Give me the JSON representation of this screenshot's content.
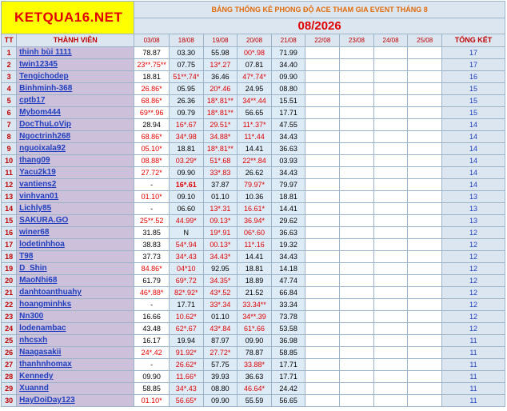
{
  "logo": "KETQUA16.NET",
  "title": "BẢNG THỐNG KÊ PHONG ĐỘ ACE THAM GIA EVENT THÁNG 8",
  "subtitle": "08/2026",
  "headers": {
    "tt": "TT",
    "name": "THÀNH VIÊN",
    "dates": [
      "03/08",
      "18/08",
      "19/08",
      "20/08",
      "21/08",
      "22/08",
      "23/08",
      "24/08",
      "25/08"
    ],
    "total": "TỔNG KẾT"
  },
  "colors": {
    "logo_bg": "#ffff00",
    "logo_text": "#e00000",
    "name_bg": "#ccc0da",
    "name_text": "#1f3fbf",
    "red_score": "#e00000",
    "header_bg": "#dce6f1"
  },
  "rows": [
    {
      "tt": "1",
      "name": "thinh bùi 1111",
      "scores": [
        {
          "v": "78.87",
          "r": 0
        },
        {
          "v": "03.30",
          "r": 0
        },
        {
          "v": "55.98",
          "r": 0
        },
        {
          "v": "00*.98",
          "r": 1
        },
        {
          "v": "71.99",
          "r": 0
        }
      ],
      "total": "17"
    },
    {
      "tt": "2",
      "name": "twin12345",
      "scores": [
        {
          "v": "23**.75**",
          "r": 1
        },
        {
          "v": "07.75",
          "r": 0
        },
        {
          "v": "13*.27",
          "r": 1
        },
        {
          "v": "07.81",
          "r": 0
        },
        {
          "v": "34.40",
          "r": 0
        }
      ],
      "total": "17"
    },
    {
      "tt": "3",
      "name": "Tengichodep",
      "scores": [
        {
          "v": "18.81",
          "r": 0
        },
        {
          "v": "51**.74*",
          "r": 1
        },
        {
          "v": "36.46",
          "r": 0
        },
        {
          "v": "47*.74*",
          "r": 1
        },
        {
          "v": "09.90",
          "r": 0
        }
      ],
      "total": "16"
    },
    {
      "tt": "4",
      "name": "Binhminh-368",
      "scores": [
        {
          "v": "26.86*",
          "r": 1
        },
        {
          "v": "05.95",
          "r": 0
        },
        {
          "v": "20*.46",
          "r": 1
        },
        {
          "v": "24.95",
          "r": 0
        },
        {
          "v": "08.80",
          "r": 0
        }
      ],
      "total": "15"
    },
    {
      "tt": "5",
      "name": "cptb17",
      "scores": [
        {
          "v": "68.86*",
          "r": 1
        },
        {
          "v": "26.36",
          "r": 0
        },
        {
          "v": "18*.81**",
          "r": 1
        },
        {
          "v": "34**.44",
          "r": 1
        },
        {
          "v": "15.51",
          "r": 0
        }
      ],
      "total": "15"
    },
    {
      "tt": "6",
      "name": "Mybom444",
      "scores": [
        {
          "v": "69**.96",
          "r": 1
        },
        {
          "v": "09.79",
          "r": 0
        },
        {
          "v": "18*.81**",
          "r": 1
        },
        {
          "v": "56.65",
          "r": 0
        },
        {
          "v": "17.71",
          "r": 0
        }
      ],
      "total": "15"
    },
    {
      "tt": "7",
      "name": "DocThuLoVip",
      "scores": [
        {
          "v": "28.94",
          "r": 0
        },
        {
          "v": "16*.67",
          "r": 1
        },
        {
          "v": "29.51*",
          "r": 1
        },
        {
          "v": "11*.37*",
          "r": 1
        },
        {
          "v": "47.55",
          "r": 0
        }
      ],
      "total": "14"
    },
    {
      "tt": "8",
      "name": "Ngoctrinh268",
      "scores": [
        {
          "v": "68.86*",
          "r": 1
        },
        {
          "v": "34*.98",
          "r": 1
        },
        {
          "v": "34.88*",
          "r": 1
        },
        {
          "v": "11*.44",
          "r": 1
        },
        {
          "v": "34.43",
          "r": 0
        }
      ],
      "total": "14"
    },
    {
      "tt": "9",
      "name": "nguoixala92",
      "scores": [
        {
          "v": "05.10*",
          "r": 1
        },
        {
          "v": "18.81",
          "r": 0
        },
        {
          "v": "18*.81**",
          "r": 1
        },
        {
          "v": "14.41",
          "r": 0
        },
        {
          "v": "36.63",
          "r": 0
        }
      ],
      "total": "14"
    },
    {
      "tt": "10",
      "name": "thang09",
      "scores": [
        {
          "v": "08.88*",
          "r": 1
        },
        {
          "v": "03.29*",
          "r": 1
        },
        {
          "v": "51*.68",
          "r": 1
        },
        {
          "v": "22**.84",
          "r": 1
        },
        {
          "v": "03.93",
          "r": 0
        }
      ],
      "total": "14"
    },
    {
      "tt": "11",
      "name": "Yacu2k19",
      "scores": [
        {
          "v": "27.72*",
          "r": 1
        },
        {
          "v": "09.90",
          "r": 0
        },
        {
          "v": "33*.83",
          "r": 1
        },
        {
          "v": "26.62",
          "r": 0
        },
        {
          "v": "34.43",
          "r": 0
        }
      ],
      "total": "14"
    },
    {
      "tt": "12",
      "name": "vantiens2",
      "scores": [
        {
          "v": "-",
          "r": 0
        },
        {
          "v": "16*.61",
          "r": 1,
          "b": 1
        },
        {
          "v": "37.87",
          "r": 0
        },
        {
          "v": "79.97*",
          "r": 1
        },
        {
          "v": "79.97",
          "r": 0
        }
      ],
      "total": "14"
    },
    {
      "tt": "13",
      "name": "vinhvan01",
      "scores": [
        {
          "v": "01.10*",
          "r": 1
        },
        {
          "v": "09.10",
          "r": 0
        },
        {
          "v": "01.10",
          "r": 0
        },
        {
          "v": "10.36",
          "r": 0
        },
        {
          "v": "18.81",
          "r": 0
        }
      ],
      "total": "13"
    },
    {
      "tt": "14",
      "name": "Lichly85",
      "scores": [
        {
          "v": "-",
          "r": 0
        },
        {
          "v": "06.60",
          "r": 0
        },
        {
          "v": "13*.31",
          "r": 1
        },
        {
          "v": "16.61*",
          "r": 1
        },
        {
          "v": "14.41",
          "r": 0
        }
      ],
      "total": "13"
    },
    {
      "tt": "15",
      "name": "SAKURA.GO",
      "scores": [
        {
          "v": "25**.52",
          "r": 1
        },
        {
          "v": "44.99*",
          "r": 1
        },
        {
          "v": "09.13*",
          "r": 1
        },
        {
          "v": "36.94*",
          "r": 1
        },
        {
          "v": "29.62",
          "r": 0
        }
      ],
      "total": "13"
    },
    {
      "tt": "16",
      "name": "winer68",
      "scores": [
        {
          "v": "31.85",
          "r": 0
        },
        {
          "v": "N",
          "r": 0
        },
        {
          "v": "19*.91",
          "r": 1
        },
        {
          "v": "06*.60",
          "r": 1
        },
        {
          "v": "36.63",
          "r": 0
        }
      ],
      "total": "12"
    },
    {
      "tt": "17",
      "name": "lodetinhhoa",
      "scores": [
        {
          "v": "38.83",
          "r": 0
        },
        {
          "v": "54*.94",
          "r": 1
        },
        {
          "v": "00.13*",
          "r": 1
        },
        {
          "v": "11*.16",
          "r": 1
        },
        {
          "v": "19.32",
          "r": 0
        }
      ],
      "total": "12"
    },
    {
      "tt": "18",
      "name": "T98",
      "scores": [
        {
          "v": "37.73",
          "r": 0
        },
        {
          "v": "34*.43",
          "r": 1
        },
        {
          "v": "34.43*",
          "r": 1
        },
        {
          "v": "14.41",
          "r": 0
        },
        {
          "v": "34.43",
          "r": 0
        }
      ],
      "total": "12"
    },
    {
      "tt": "19",
      "name": "D_Shin",
      "scores": [
        {
          "v": "84.86*",
          "r": 1
        },
        {
          "v": "04*10",
          "r": 1
        },
        {
          "v": "92.95",
          "r": 0
        },
        {
          "v": "18.81",
          "r": 0
        },
        {
          "v": "14.18",
          "r": 0
        }
      ],
      "total": "12"
    },
    {
      "tt": "20",
      "name": "MaoNhi68",
      "scores": [
        {
          "v": "61.79",
          "r": 0
        },
        {
          "v": "69*.72",
          "r": 1
        },
        {
          "v": "34.35*",
          "r": 1
        },
        {
          "v": "18.89",
          "r": 0
        },
        {
          "v": "47.74",
          "r": 0
        }
      ],
      "total": "12"
    },
    {
      "tt": "21",
      "name": "danhtoanthuahy",
      "scores": [
        {
          "v": "46*.88*",
          "r": 1
        },
        {
          "v": "82*.92*",
          "r": 1
        },
        {
          "v": "43*.52",
          "r": 1
        },
        {
          "v": "21.52",
          "r": 0
        },
        {
          "v": "66.84",
          "r": 0
        }
      ],
      "total": "12"
    },
    {
      "tt": "22",
      "name": "hoangminhks",
      "scores": [
        {
          "v": "-",
          "r": 0
        },
        {
          "v": "17.71",
          "r": 0
        },
        {
          "v": "33*.34",
          "r": 1
        },
        {
          "v": "33.34**",
          "r": 1
        },
        {
          "v": "33.34",
          "r": 0
        }
      ],
      "total": "12"
    },
    {
      "tt": "23",
      "name": "Nn300",
      "scores": [
        {
          "v": "16.66",
          "r": 0
        },
        {
          "v": "10.62*",
          "r": 1
        },
        {
          "v": "01.10",
          "r": 0
        },
        {
          "v": "34**.39",
          "r": 1
        },
        {
          "v": "73.78",
          "r": 0
        }
      ],
      "total": "12"
    },
    {
      "tt": "24",
      "name": "lodenambac",
      "scores": [
        {
          "v": "43.48",
          "r": 0
        },
        {
          "v": "62*.67",
          "r": 1
        },
        {
          "v": "43*.84",
          "r": 1
        },
        {
          "v": "61*.66",
          "r": 1
        },
        {
          "v": "53.58",
          "r": 0
        }
      ],
      "total": "12"
    },
    {
      "tt": "25",
      "name": "nhcsxh",
      "scores": [
        {
          "v": "16.17",
          "r": 0
        },
        {
          "v": "19.94",
          "r": 0
        },
        {
          "v": "87.97",
          "r": 0
        },
        {
          "v": "09.90",
          "r": 0
        },
        {
          "v": "36.98",
          "r": 0
        }
      ],
      "total": "11"
    },
    {
      "tt": "26",
      "name": "Naagasakii",
      "scores": [
        {
          "v": "24*.42",
          "r": 1
        },
        {
          "v": "91.92*",
          "r": 1
        },
        {
          "v": "27.72*",
          "r": 1
        },
        {
          "v": "78.87",
          "r": 0
        },
        {
          "v": "58.85",
          "r": 0
        }
      ],
      "total": "11"
    },
    {
      "tt": "27",
      "name": "thanhnhomax",
      "scores": [
        {
          "v": "-",
          "r": 0
        },
        {
          "v": "26.62*",
          "r": 1
        },
        {
          "v": "57.75",
          "r": 0
        },
        {
          "v": "33.88*",
          "r": 1
        },
        {
          "v": "17.71",
          "r": 0
        }
      ],
      "total": "11"
    },
    {
      "tt": "28",
      "name": "Kennedy",
      "scores": [
        {
          "v": "09.90",
          "r": 0
        },
        {
          "v": "11.66*",
          "r": 1
        },
        {
          "v": "39.93",
          "r": 0
        },
        {
          "v": "36.63",
          "r": 0
        },
        {
          "v": "17.71",
          "r": 0
        }
      ],
      "total": "11"
    },
    {
      "tt": "29",
      "name": "Xuannd",
      "scores": [
        {
          "v": "58.85",
          "r": 0
        },
        {
          "v": "34*.43",
          "r": 1
        },
        {
          "v": "08.80",
          "r": 0
        },
        {
          "v": "46.64*",
          "r": 1
        },
        {
          "v": "24.42",
          "r": 0
        }
      ],
      "total": "11"
    },
    {
      "tt": "30",
      "name": "HayDoiDay123",
      "scores": [
        {
          "v": "01.10*",
          "r": 1
        },
        {
          "v": "56.65*",
          "r": 1
        },
        {
          "v": "09.90",
          "r": 0
        },
        {
          "v": "55.59",
          "r": 0
        },
        {
          "v": "56.65",
          "r": 0
        }
      ],
      "total": "11"
    }
  ]
}
